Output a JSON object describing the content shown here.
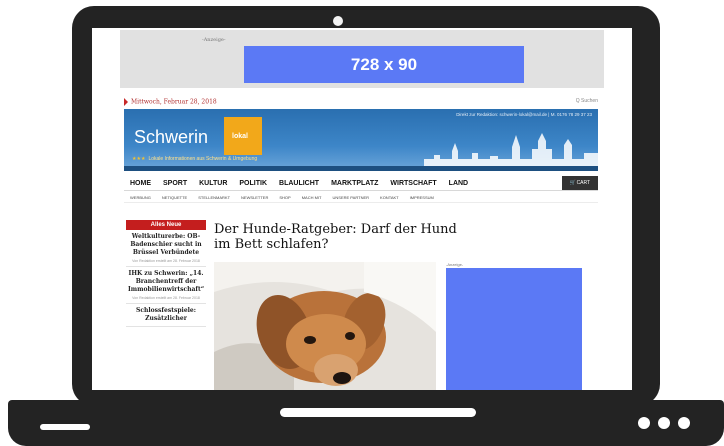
{
  "site": {
    "ad_top_label": "-Anzeige-",
    "ad_top_size": "728 x 90",
    "date": "Mittwoch, Februar 28, 2018",
    "search": "Q Suchen",
    "contact": "Direkt zur Redaktion: schwerin-lokal@mail.de | M. 0176 78 29 37 23",
    "logo_text": "Schwerin",
    "logo_badge": "lokal",
    "tagline": "Lokale Informationen aus Schwerin & Umgebung",
    "nav": [
      "HOME",
      "SPORT",
      "KULTUR",
      "POLITIK",
      "BLAULICHT",
      "MARKTPLATZ",
      "WIRTSCHAFT",
      "LAND"
    ],
    "cart": "CART",
    "subnav": [
      "WERBUNG",
      "NETIQUETTE",
      "STELLENMARKT",
      "NEWSLETTER",
      "SHOP",
      "MACH MIT",
      "UNSERE PARTNER",
      "KONTAKT",
      "IMPRESSUM"
    ],
    "sidebar_header": "Alles Neue",
    "sidebar_items": [
      {
        "title": "Weltkulturerbe: OB-Badenschier sucht in Brüssel Verbündete",
        "meta": "Von Redaktion erstellt am 28. Februar 2018"
      },
      {
        "title": "IHK zu Schwerin: „14. Branchentreff der Immobilienwirtschaft“",
        "meta": "Von Redaktion erstellt am 28. Februar 2018"
      },
      {
        "title": "Schlossfestspiele: Zusätzlicher",
        "meta": ""
      }
    ],
    "headline": "Der Hunde-Ratgeber: Darf der Hund im Bett schlafen?",
    "ad_side_label": "-Anzeige-"
  },
  "colors": {
    "laptop": "#232323",
    "ad_blue": "#5b79f5",
    "masthead_blue": "#2a6fb0",
    "logo_orange": "#f2a81a",
    "sidebar_red": "#c41e1e"
  }
}
